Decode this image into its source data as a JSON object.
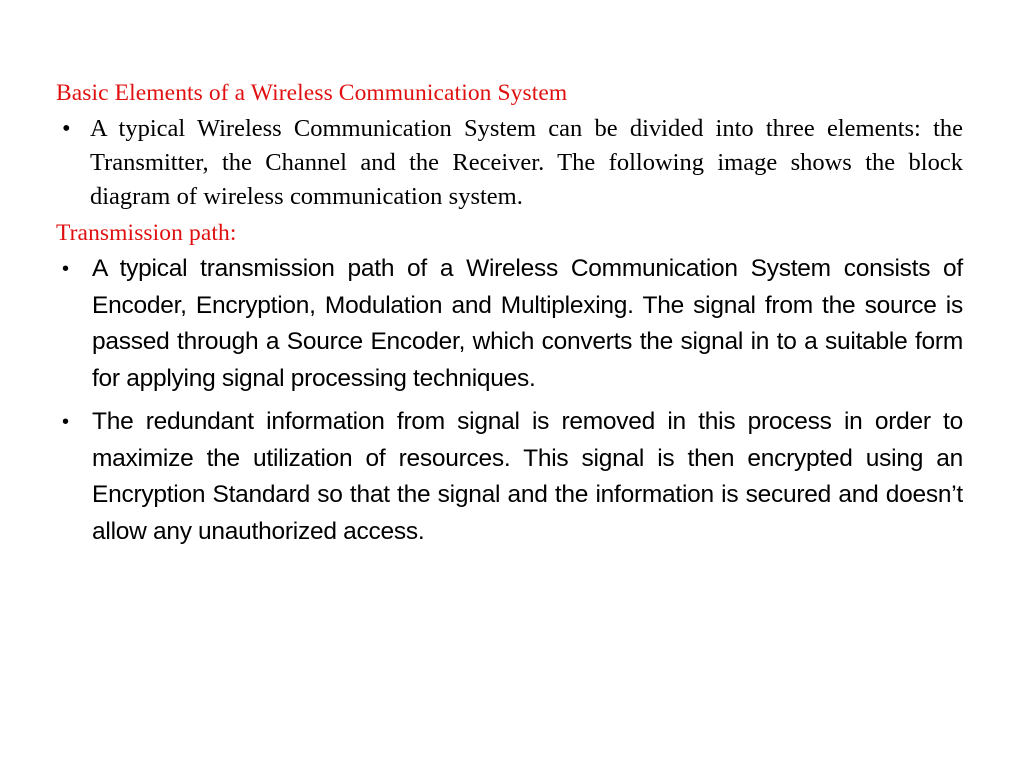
{
  "slide": {
    "background_color": "#ffffff",
    "heading_color": "#e01010",
    "body_color": "#000000",
    "bullet_glyph": "•"
  },
  "headings": {
    "title": "Basic Elements of a Wireless Communication System",
    "section": "Transmission path:"
  },
  "bullets": [
    {
      "marker": "•",
      "text": "A typical Wireless Communication System can be divided into three elements: the Transmitter, the Channel and the Receiver. The following image shows the block diagram of wireless communication system."
    },
    {
      "marker": "•",
      "text": "A typical transmission path of a Wireless Communication System consists of Encoder, Encryption, Modulation and Multiplexing. The signal from the source is passed through a Source Encoder, which converts the signal in to a suitable form for applying signal processing techniques."
    },
    {
      "marker": "•",
      "text": "The redundant information from signal is removed in this process in order to maximize the utilization of resources. This signal is then encrypted using an Encryption Standard so that the signal and the information is secured and doesn’t allow any unauthorized access."
    }
  ]
}
